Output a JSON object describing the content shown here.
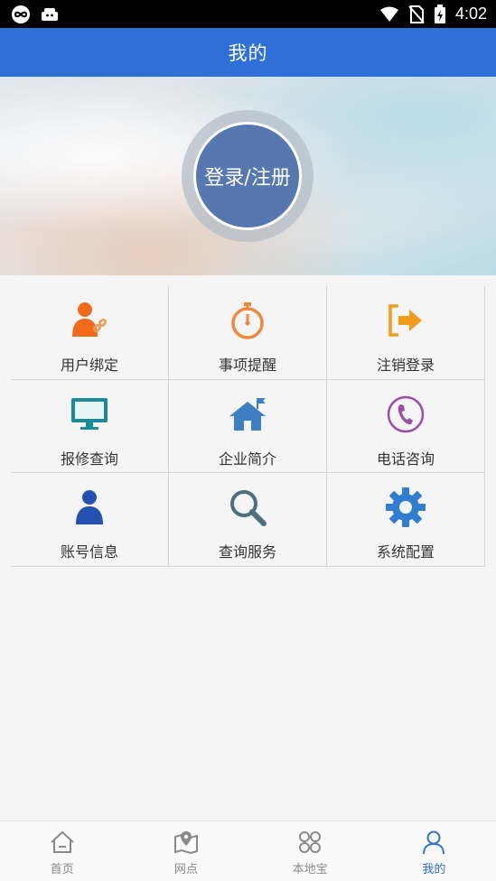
{
  "status_bar": {
    "time": "4:02",
    "left_icons": [
      "infinity-icon",
      "android-icon"
    ],
    "right_icons": [
      "wifi-icon",
      "no-sim-icon",
      "battery-icon"
    ]
  },
  "header": {
    "title": "我的"
  },
  "profile": {
    "login_label": "登录/注册"
  },
  "grid": {
    "items": [
      {
        "label": "用户绑定",
        "icon": "user-link-icon",
        "color": "#f26a1b"
      },
      {
        "label": "事项提醒",
        "icon": "stopwatch-icon",
        "color": "#f0883a"
      },
      {
        "label": "注销登录",
        "icon": "logout-icon",
        "color": "#f39c1a"
      },
      {
        "label": "报修查询",
        "icon": "monitor-icon",
        "color": "#1b8a99"
      },
      {
        "label": "企业简介",
        "icon": "house-icon",
        "color": "#3f7fc4"
      },
      {
        "label": "电话咨询",
        "icon": "phone-icon",
        "color": "#9a4ea6"
      },
      {
        "label": "账号信息",
        "icon": "person-icon",
        "color": "#2352b2"
      },
      {
        "label": "查询服务",
        "icon": "magnifier-icon",
        "color": "#4e6e80"
      },
      {
        "label": "系统配置",
        "icon": "gear-icon",
        "color": "#2f7ed2"
      }
    ]
  },
  "bottom_nav": {
    "items": [
      {
        "label": "首页",
        "icon": "home-icon",
        "active": false
      },
      {
        "label": "网点",
        "icon": "map-pin-icon",
        "active": false
      },
      {
        "label": "本地宝",
        "icon": "four-petal-icon",
        "active": false
      },
      {
        "label": "我的",
        "icon": "profile-icon",
        "active": true
      }
    ],
    "active_color": "#2e6fd8",
    "inactive_color": "#8a8a8a"
  }
}
